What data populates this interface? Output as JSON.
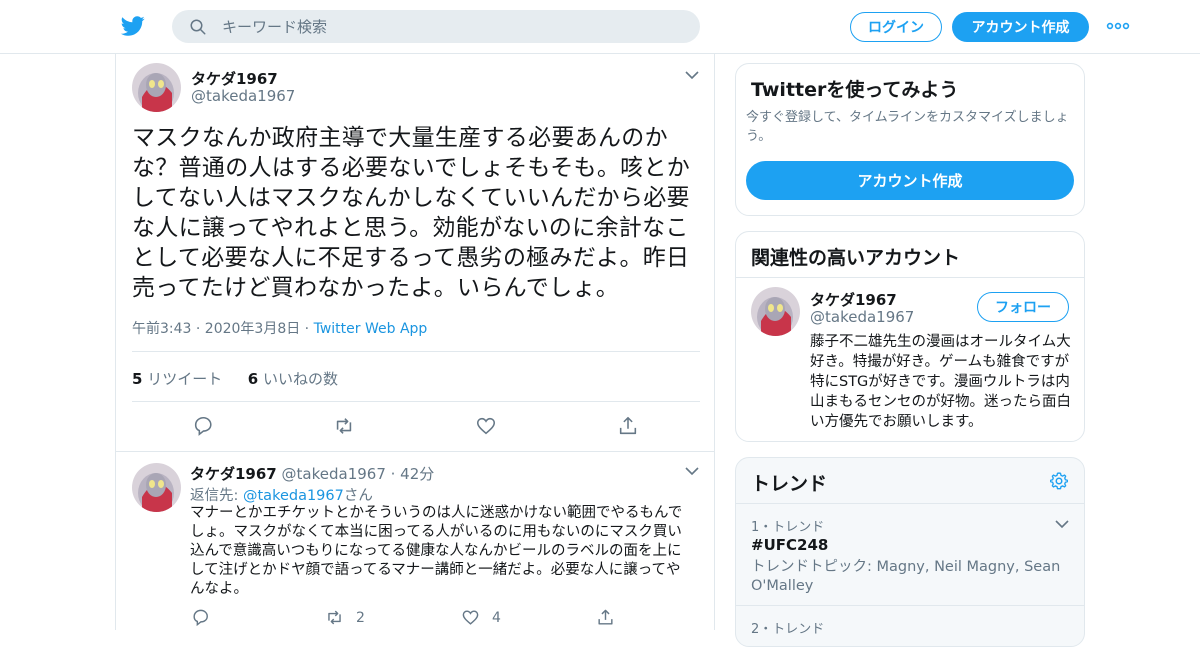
{
  "header": {
    "search_placeholder": "キーワード検索",
    "login_label": "ログイン",
    "signup_label": "アカウント作成"
  },
  "tweet": {
    "name": "タケダ1967",
    "handle": "@takeda1967",
    "text": "マスクなんか政府主導で大量生産する必要あんのかな？普通の人はする必要ないでしょそもそも。咳とかしてない人はマスクなんかしなくていいんだから必要な人に譲ってやれよと思う。効能がないのに余計なことして必要な人に不足するって愚劣の極みだよ。昨日売ってたけど買わなかったよ。いらんでしょ。",
    "time": "午前3:43 · 2020年3月8日 · ",
    "source": "Twitter Web App",
    "retweets_count": "5",
    "retweets_label": "リツイート",
    "likes_count": "6",
    "likes_label": "いいねの数"
  },
  "reply": {
    "name": "タケダ1967",
    "handle": "@takeda1967 · 42分",
    "reply_to_prefix": "返信先: ",
    "reply_to_handle": "@takeda1967",
    "reply_to_suffix": "さん",
    "text": "マナーとかエチケットとかそういうのは人に迷惑かけない範囲でやるもんでしょ。マスクがなくて本当に困ってる人がいるのに用もないのにマスク買い込んで意識高いつもりになってる健康な人なんかビールのラベルの面を上にして注げとかドヤ顔で語ってるマナー講師と一緒だよ。必要な人に譲ってやんなよ。",
    "retweets": "2",
    "likes": "4"
  },
  "signup_card": {
    "title": "Twitterを使ってみよう",
    "desc": "今すぐ登録して、タイムラインをカスタマイズしましょう。",
    "button": "アカウント作成"
  },
  "related_card": {
    "title": "関連性の高いアカウント",
    "name": "タケダ1967",
    "handle": "@takeda1967",
    "follow": "フォロー",
    "bio": "藤子不二雄先生の漫画はオールタイム大好き。特撮が好き。ゲームも雑食ですが特にSTGが好きです。漫画ウルトラは内山まもるセンセのが好物。迷ったら面白い方優先でお願いします。"
  },
  "trends": {
    "title": "トレンド",
    "items": [
      {
        "meta": "1・トレンド",
        "name": "#UFC248",
        "desc": "トレンドトピック: Magny, Neil Magny, Sean O'Malley"
      },
      {
        "meta": "2・トレンド"
      }
    ]
  },
  "icons": [
    "twitter-bird-icon",
    "search-icon",
    "more-icon",
    "chevron-down-icon",
    "reply-icon",
    "retweet-icon",
    "like-icon",
    "share-icon",
    "gear-icon"
  ],
  "colors": {
    "accent": "#1da1f2",
    "link": "#1b95e0",
    "muted": "#657786",
    "border": "#e1e8ed"
  }
}
